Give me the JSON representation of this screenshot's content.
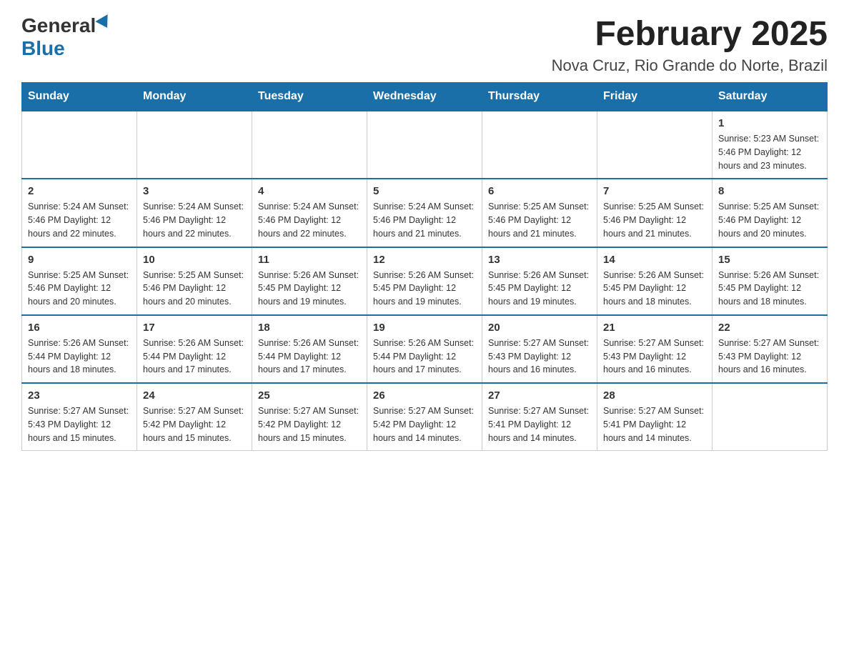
{
  "header": {
    "logo_general": "General",
    "logo_blue": "Blue",
    "title": "February 2025",
    "subtitle": "Nova Cruz, Rio Grande do Norte, Brazil"
  },
  "weekdays": [
    "Sunday",
    "Monday",
    "Tuesday",
    "Wednesday",
    "Thursday",
    "Friday",
    "Saturday"
  ],
  "weeks": [
    [
      {
        "day": "",
        "info": ""
      },
      {
        "day": "",
        "info": ""
      },
      {
        "day": "",
        "info": ""
      },
      {
        "day": "",
        "info": ""
      },
      {
        "day": "",
        "info": ""
      },
      {
        "day": "",
        "info": ""
      },
      {
        "day": "1",
        "info": "Sunrise: 5:23 AM\nSunset: 5:46 PM\nDaylight: 12 hours and 23 minutes."
      }
    ],
    [
      {
        "day": "2",
        "info": "Sunrise: 5:24 AM\nSunset: 5:46 PM\nDaylight: 12 hours and 22 minutes."
      },
      {
        "day": "3",
        "info": "Sunrise: 5:24 AM\nSunset: 5:46 PM\nDaylight: 12 hours and 22 minutes."
      },
      {
        "day": "4",
        "info": "Sunrise: 5:24 AM\nSunset: 5:46 PM\nDaylight: 12 hours and 22 minutes."
      },
      {
        "day": "5",
        "info": "Sunrise: 5:24 AM\nSunset: 5:46 PM\nDaylight: 12 hours and 21 minutes."
      },
      {
        "day": "6",
        "info": "Sunrise: 5:25 AM\nSunset: 5:46 PM\nDaylight: 12 hours and 21 minutes."
      },
      {
        "day": "7",
        "info": "Sunrise: 5:25 AM\nSunset: 5:46 PM\nDaylight: 12 hours and 21 minutes."
      },
      {
        "day": "8",
        "info": "Sunrise: 5:25 AM\nSunset: 5:46 PM\nDaylight: 12 hours and 20 minutes."
      }
    ],
    [
      {
        "day": "9",
        "info": "Sunrise: 5:25 AM\nSunset: 5:46 PM\nDaylight: 12 hours and 20 minutes."
      },
      {
        "day": "10",
        "info": "Sunrise: 5:25 AM\nSunset: 5:46 PM\nDaylight: 12 hours and 20 minutes."
      },
      {
        "day": "11",
        "info": "Sunrise: 5:26 AM\nSunset: 5:45 PM\nDaylight: 12 hours and 19 minutes."
      },
      {
        "day": "12",
        "info": "Sunrise: 5:26 AM\nSunset: 5:45 PM\nDaylight: 12 hours and 19 minutes."
      },
      {
        "day": "13",
        "info": "Sunrise: 5:26 AM\nSunset: 5:45 PM\nDaylight: 12 hours and 19 minutes."
      },
      {
        "day": "14",
        "info": "Sunrise: 5:26 AM\nSunset: 5:45 PM\nDaylight: 12 hours and 18 minutes."
      },
      {
        "day": "15",
        "info": "Sunrise: 5:26 AM\nSunset: 5:45 PM\nDaylight: 12 hours and 18 minutes."
      }
    ],
    [
      {
        "day": "16",
        "info": "Sunrise: 5:26 AM\nSunset: 5:44 PM\nDaylight: 12 hours and 18 minutes."
      },
      {
        "day": "17",
        "info": "Sunrise: 5:26 AM\nSunset: 5:44 PM\nDaylight: 12 hours and 17 minutes."
      },
      {
        "day": "18",
        "info": "Sunrise: 5:26 AM\nSunset: 5:44 PM\nDaylight: 12 hours and 17 minutes."
      },
      {
        "day": "19",
        "info": "Sunrise: 5:26 AM\nSunset: 5:44 PM\nDaylight: 12 hours and 17 minutes."
      },
      {
        "day": "20",
        "info": "Sunrise: 5:27 AM\nSunset: 5:43 PM\nDaylight: 12 hours and 16 minutes."
      },
      {
        "day": "21",
        "info": "Sunrise: 5:27 AM\nSunset: 5:43 PM\nDaylight: 12 hours and 16 minutes."
      },
      {
        "day": "22",
        "info": "Sunrise: 5:27 AM\nSunset: 5:43 PM\nDaylight: 12 hours and 16 minutes."
      }
    ],
    [
      {
        "day": "23",
        "info": "Sunrise: 5:27 AM\nSunset: 5:43 PM\nDaylight: 12 hours and 15 minutes."
      },
      {
        "day": "24",
        "info": "Sunrise: 5:27 AM\nSunset: 5:42 PM\nDaylight: 12 hours and 15 minutes."
      },
      {
        "day": "25",
        "info": "Sunrise: 5:27 AM\nSunset: 5:42 PM\nDaylight: 12 hours and 15 minutes."
      },
      {
        "day": "26",
        "info": "Sunrise: 5:27 AM\nSunset: 5:42 PM\nDaylight: 12 hours and 14 minutes."
      },
      {
        "day": "27",
        "info": "Sunrise: 5:27 AM\nSunset: 5:41 PM\nDaylight: 12 hours and 14 minutes."
      },
      {
        "day": "28",
        "info": "Sunrise: 5:27 AM\nSunset: 5:41 PM\nDaylight: 12 hours and 14 minutes."
      },
      {
        "day": "",
        "info": ""
      }
    ]
  ]
}
